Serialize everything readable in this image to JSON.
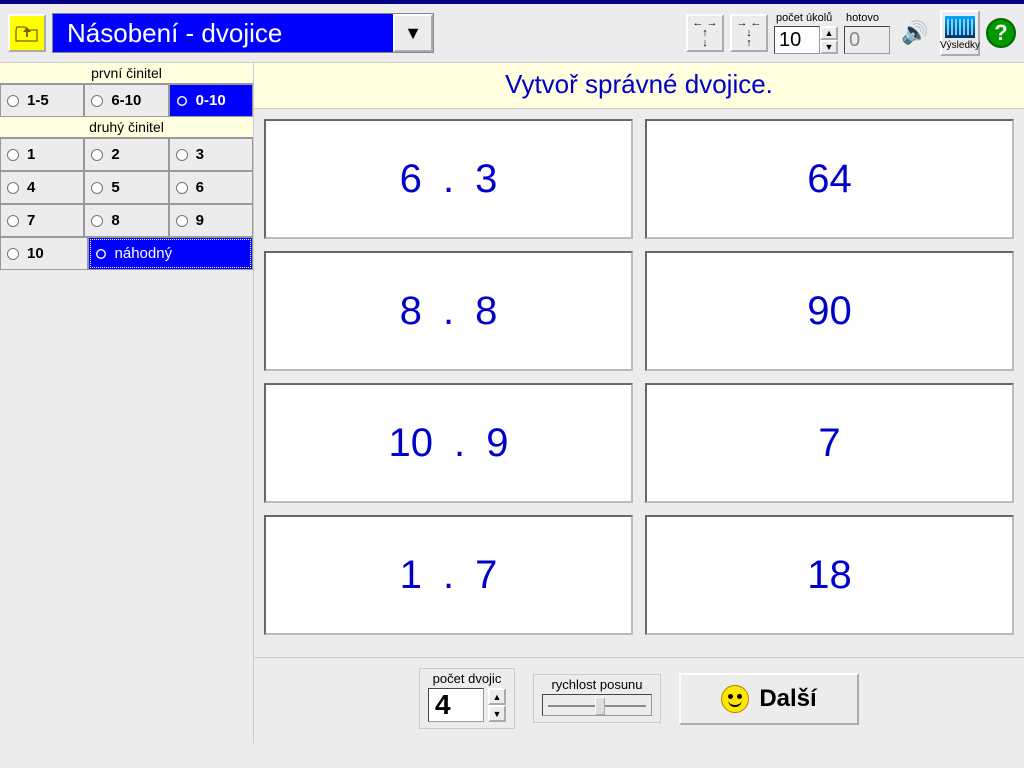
{
  "header": {
    "title": "Násobení - dvojice",
    "task_count_label": "počet úkolů",
    "task_count_value": "10",
    "done_label": "hotovo",
    "done_value": "0",
    "results_label": "Výsledky"
  },
  "sidebar": {
    "first_factor_label": "první činitel",
    "first_factor_options": [
      "1-5",
      "6-10",
      "0-10"
    ],
    "first_factor_selected": 2,
    "second_factor_label": "druhý činitel",
    "second_factor_options": [
      "1",
      "2",
      "3",
      "4",
      "5",
      "6",
      "7",
      "8",
      "9",
      "10",
      "náhodný"
    ],
    "second_factor_selected": 10
  },
  "instruction": "Vytvoř správné dvojice.",
  "pairs": {
    "left": [
      "6  .  3",
      "8  .  8",
      "10  .  9",
      "1  .  7"
    ],
    "right": [
      "64",
      "90",
      "7",
      "18"
    ]
  },
  "bottom": {
    "pairs_label": "počet dvojic",
    "pairs_value": "4",
    "speed_label": "rychlost posunu",
    "next_label": "Další"
  }
}
